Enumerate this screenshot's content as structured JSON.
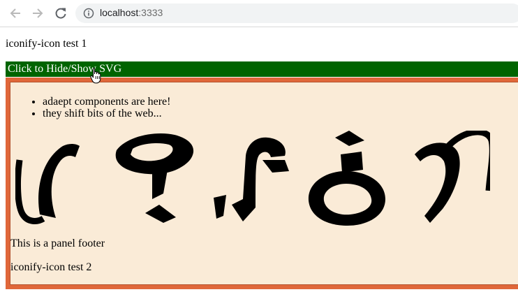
{
  "browser": {
    "url_host": "localhost",
    "url_port": ":3333",
    "icons": [
      "back-arrow-icon",
      "forward-arrow-icon",
      "reload-icon",
      "info-icon"
    ]
  },
  "page": {
    "test1_text": "iconify-icon test 1",
    "toggle_label": "Click to Hide/Show SVG",
    "list_items": [
      "adaept components are here!",
      "they shift bits of the web..."
    ],
    "footer_text": "This is a panel footer",
    "test2_text": "iconify-icon test 2"
  },
  "colors": {
    "toggle_bg": "#006400",
    "panel_bg": "#faebd7",
    "panel_border": "#e0673a"
  }
}
